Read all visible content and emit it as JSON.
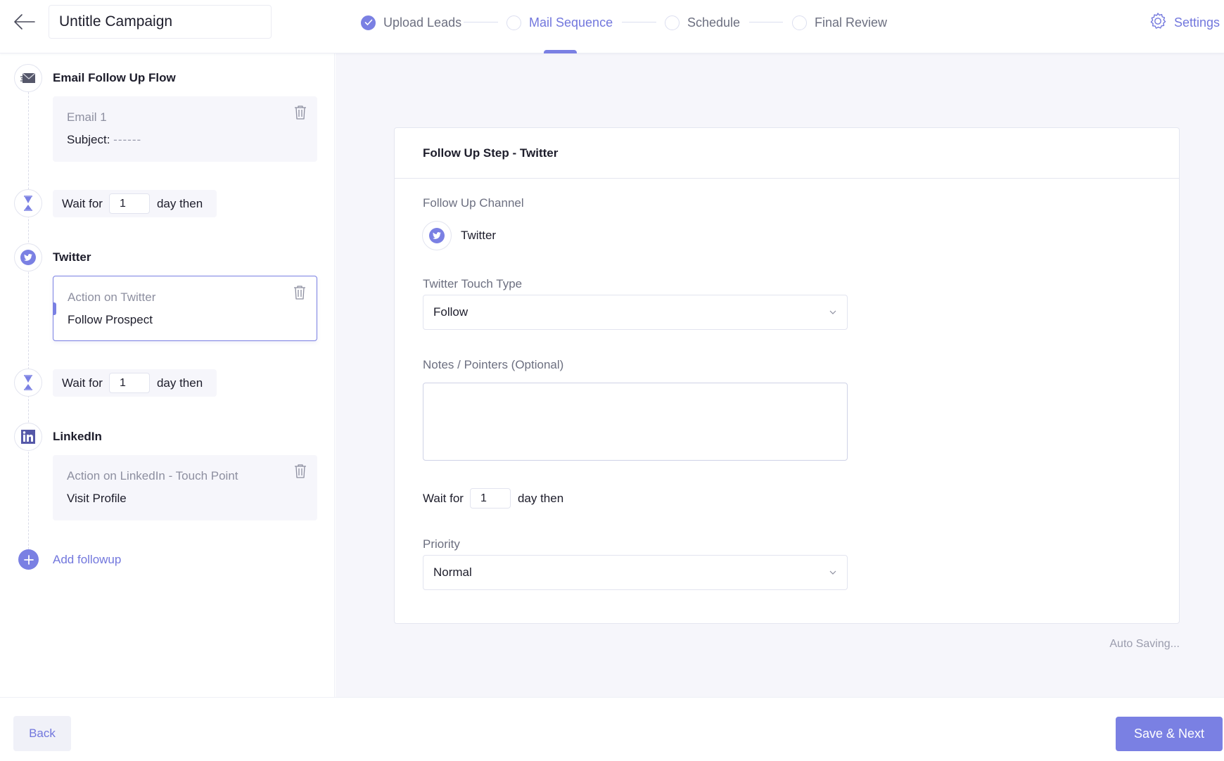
{
  "header": {
    "campaign_title": "Untitle Campaign",
    "steps": [
      {
        "label": "Upload Leads",
        "state": "completed"
      },
      {
        "label": "Mail Sequence",
        "state": "active"
      },
      {
        "label": "Schedule",
        "state": "pending"
      },
      {
        "label": "Final Review",
        "state": "pending"
      }
    ],
    "settings_label": "Settings",
    "icons": {
      "back": "arrow-left-icon",
      "settings": "gear-icon",
      "step_done": "check-circle-icon"
    }
  },
  "sequence": {
    "items": [
      {
        "type": "channel",
        "icon": "envelope-icon",
        "title": "Email Follow Up Flow",
        "card": {
          "subtitle": "Email 1",
          "main_label": "Subject:",
          "main_value": "------",
          "selected": false
        }
      },
      {
        "type": "wait",
        "icon": "hourglass-icon",
        "prefix": "Wait for",
        "value": "1",
        "suffix": "day then"
      },
      {
        "type": "channel",
        "icon": "twitter-icon",
        "title": "Twitter",
        "card": {
          "subtitle": "Action on Twitter",
          "main_label": "Follow Prospect",
          "selected": true
        }
      },
      {
        "type": "wait",
        "icon": "hourglass-icon",
        "prefix": "Wait for",
        "value": "1",
        "suffix": "day then"
      },
      {
        "type": "channel",
        "icon": "linkedin-icon",
        "title": "LinkedIn",
        "card": {
          "subtitle": "Action on LinkedIn - Touch Point",
          "main_label": "Visit Profile",
          "selected": false
        }
      }
    ],
    "add_followup_label": "Add followup"
  },
  "form": {
    "title": "Follow Up Step - Twitter",
    "channel_label": "Follow Up Channel",
    "channel_value": "Twitter",
    "touch_type_label": "Twitter Touch Type",
    "touch_type_value": "Follow",
    "notes_label": "Notes / Pointers (Optional)",
    "notes_value": "",
    "wait_prefix": "Wait for",
    "wait_value": "1",
    "wait_suffix": "day then",
    "priority_label": "Priority",
    "priority_value": "Normal"
  },
  "status": {
    "auto_saving": "Auto Saving..."
  },
  "footer": {
    "back_label": "Back",
    "next_label": "Save & Next"
  },
  "colors": {
    "accent": "#7a80e3",
    "accent_text": "#7277dd",
    "panel_bg": "#f6f6fb",
    "border": "#e4e6f0"
  }
}
